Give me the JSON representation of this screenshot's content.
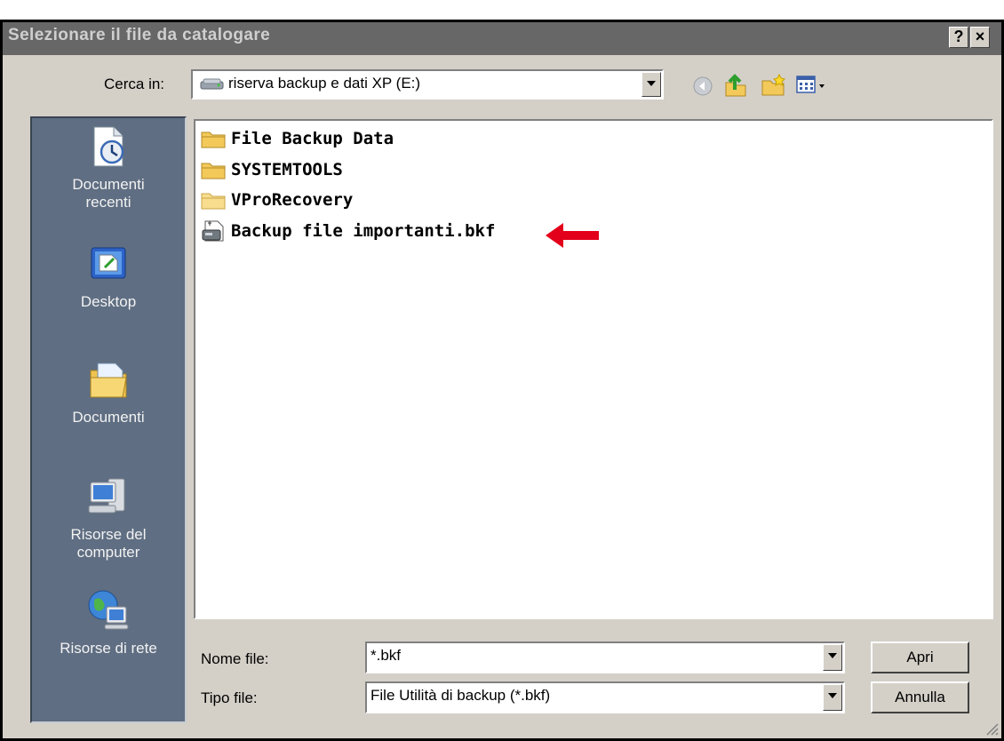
{
  "window": {
    "title": "Selezionare il file da catalogare",
    "help_label": "?",
    "close_label": "×"
  },
  "toolbar": {
    "look_in_label": "Cerca in:",
    "look_in_value": "riserva backup e dati XP (E:)"
  },
  "places": [
    {
      "label_line1": "Documenti",
      "label_line2": "recenti",
      "icon": "recent-documents-icon"
    },
    {
      "label_line1": "Desktop",
      "label_line2": "",
      "icon": "desktop-icon"
    },
    {
      "label_line1": "Documenti",
      "label_line2": "",
      "icon": "my-documents-icon"
    },
    {
      "label_line1": "Risorse del",
      "label_line2": "computer",
      "icon": "my-computer-icon"
    },
    {
      "label_line1": "Risorse di rete",
      "label_line2": "",
      "icon": "network-icon"
    }
  ],
  "files": [
    {
      "name": "File Backup Data",
      "type": "folder"
    },
    {
      "name": "SYSTEMTOOLS",
      "type": "folder"
    },
    {
      "name": "VProRecovery",
      "type": "folder"
    },
    {
      "name": "Backup file importanti.bkf",
      "type": "backup-file"
    }
  ],
  "footer": {
    "filename_label": "Nome file:",
    "filename_value": "*.bkf",
    "filetype_label": "Tipo file:",
    "filetype_value": "File Utilità di backup (*.bkf)",
    "open_label": "Apri",
    "cancel_label": "Annulla"
  },
  "colors": {
    "titlebar": "#676767",
    "places_bar": "#5f6e82",
    "annotation_arrow": "#e3001b",
    "folder": "#f3c95a"
  }
}
